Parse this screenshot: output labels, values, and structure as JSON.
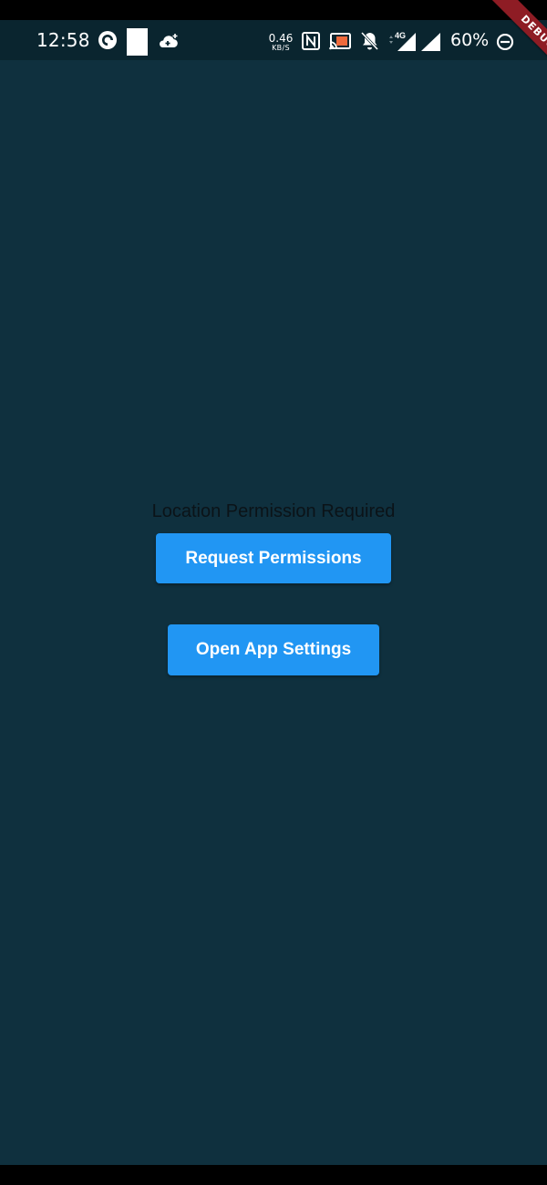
{
  "status_bar": {
    "time": "12:58",
    "net_speed_value": "0.46",
    "net_speed_unit": "KB/S",
    "network_type": "4G",
    "battery_percent": "60%",
    "icons": [
      "pocket-casts-icon",
      "notification-square-icon",
      "cloud-add-icon",
      "nfc-icon",
      "cast-icon",
      "bell-off-icon",
      "signal-4g-icon",
      "signal-icon",
      "battery-icon"
    ]
  },
  "debug_banner": {
    "label": "DEBUG"
  },
  "permission": {
    "message": "Location Permission Required",
    "request_button": "Request Permissions",
    "settings_button": "Open App Settings"
  },
  "colors": {
    "background": "#0f303e",
    "status_bar": "#0a252f",
    "button": "#2196f3",
    "debug_banner": "#8e1c24"
  }
}
